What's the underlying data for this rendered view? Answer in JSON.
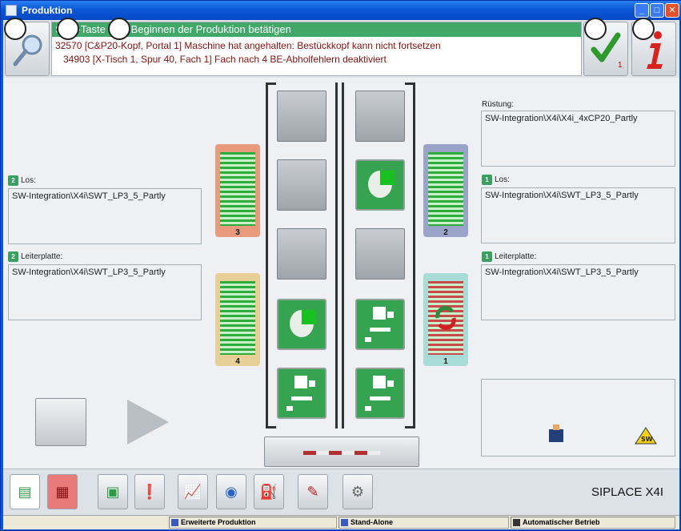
{
  "window": {
    "title": "Produktion"
  },
  "messages": {
    "header": "Start-Taste zum Beginnen der Produktion betätigen",
    "line1": "32570 [C&P20-Kopf, Portal 1] Maschine hat angehalten: Bestückkopf kann nicht fortsetzen",
    "line2": "34903 [X-Tisch 1, Spur 40, Fach 1] Fach nach 4 BE-Abholfehlern deaktiviert",
    "ok_count": "1"
  },
  "left_panels": {
    "los_label": "Los:",
    "los_value": "SW-Integration\\X4i\\SWT_LP3_5_Partly",
    "leiterplatte_label": "Leiterplatte:",
    "leiterplatte_value": "SW-Integration\\X4i\\SWT_LP3_5_Partly",
    "track_badge": "2"
  },
  "right_panels": {
    "ruestung_label": "Rüstung:",
    "ruestung_value": "SW-Integration\\X4i\\X4i_4xCP20_Partly",
    "los_label": "Los:",
    "los_value": "SW-Integration\\X4i\\SWT_LP3_5_Partly",
    "leiterplatte_label": "Leiterplatte:",
    "leiterplatte_value": "SW-Integration\\X4i\\SWT_LP3_5_Partly",
    "track_badge": "1"
  },
  "feeders": [
    {
      "number": "3",
      "color": "#e89a7c"
    },
    {
      "number": "4",
      "color": "#e8cf98"
    },
    {
      "number": "2",
      "color": "#9aa4c8"
    },
    {
      "number": "1",
      "color": "#a8dcd6"
    }
  ],
  "toolbar": {
    "product_name": "SIPLACE X4I"
  },
  "statusbar": {
    "mode": "Erweiterte Produktion",
    "line_mode": "Stand-Alone",
    "operation": "Automatischer Betrieb"
  },
  "colors": {
    "accent_green": "#41a86a",
    "error_red": "#8b1010"
  }
}
